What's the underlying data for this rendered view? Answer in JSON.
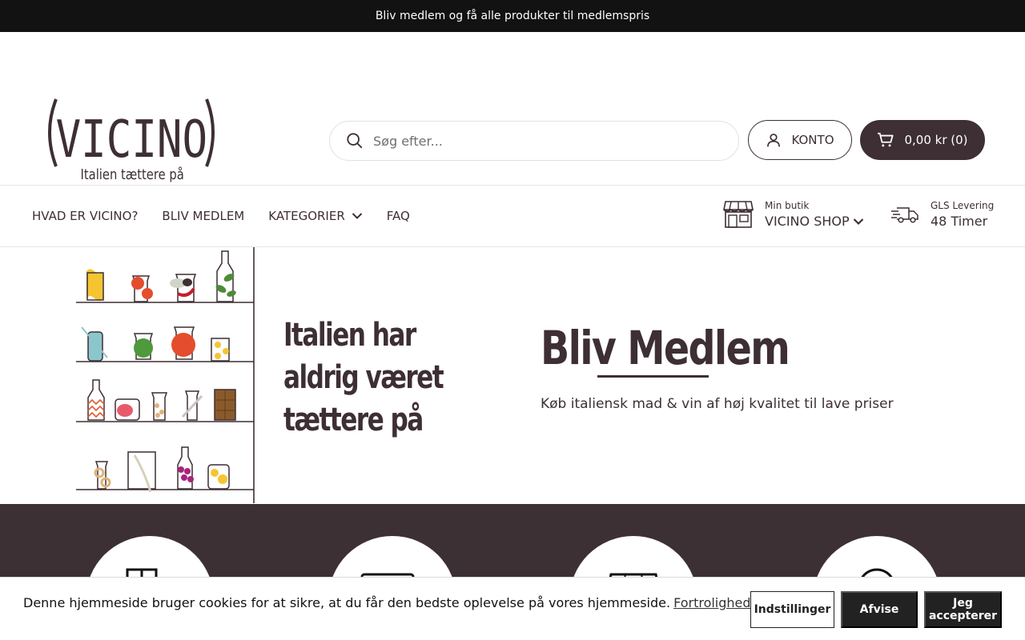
{
  "announcement": "Bliv medlem og få alle produkter til medlemspris",
  "logo": {
    "text": "VICINO",
    "tagline": "Italien tættere på"
  },
  "search": {
    "placeholder": "Søg efter..."
  },
  "account": {
    "label": "KONTO"
  },
  "cart": {
    "label": "0,00 kr (0)"
  },
  "nav": {
    "items": [
      "HVAD ER VICINO?",
      "BLIV MEDLEM",
      "KATEGORIER",
      "FAQ"
    ]
  },
  "store": {
    "label": "Min butik",
    "value": "VICINO SHOP"
  },
  "delivery": {
    "label": "GLS Levering",
    "value": "48 Timer"
  },
  "hero": {
    "slogan": [
      "Italien har",
      "aldrig været",
      "tættere på"
    ],
    "title": "Bliv Medlem",
    "subtitle": "Køb italiensk mad & vin af høj kvalitet til lave priser"
  },
  "cookie": {
    "text": "Denne hjemmeside bruger cookies for at sikre, at du får den bedste oplevelse på vores hjemmeside.",
    "link": "Fortrolighedspolitik",
    "settings": "Indstillinger",
    "reject": "Afvise",
    "accept": "Jeg accepterer"
  },
  "colors": {
    "brand": "#3d2f33",
    "topbar": "#121212",
    "button": "#222222"
  }
}
